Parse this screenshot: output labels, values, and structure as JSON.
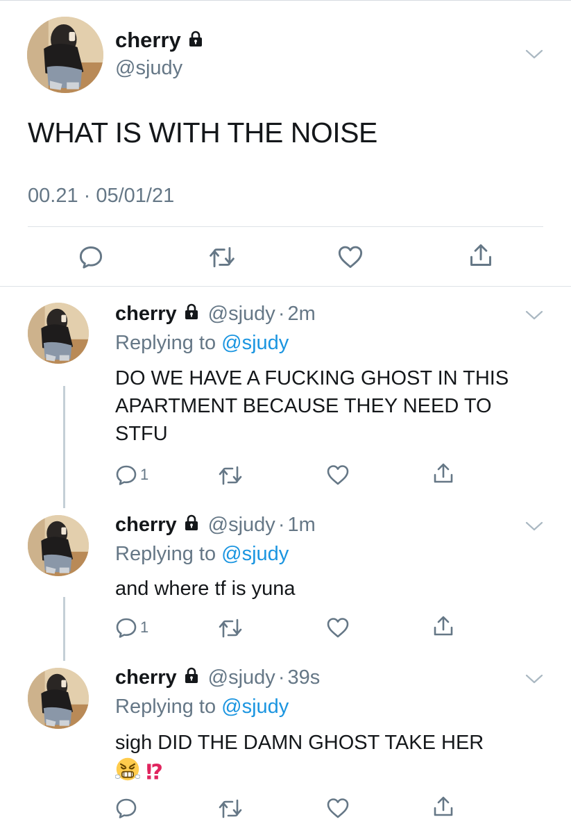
{
  "main_tweet": {
    "display_name": "cherry",
    "handle": "@sjudy",
    "text": "WHAT IS WITH THE NOISE",
    "timestamp": "00.21 · 05/01/21",
    "icons": [
      "lock-icon",
      "chevron-down-icon",
      "reply-icon",
      "retweet-icon",
      "like-icon",
      "share-icon"
    ]
  },
  "replies": [
    {
      "display_name": "cherry",
      "handle": "@sjudy",
      "separator": "·",
      "time": "2m",
      "replying_prefix": "Replying to ",
      "replying_to": "@sjudy",
      "text": "DO WE HAVE A FUCKING GHOST IN THIS APARTMENT BECAUSE THEY NEED TO STFU",
      "reply_count": "1"
    },
    {
      "display_name": "cherry",
      "handle": "@sjudy",
      "separator": "·",
      "time": "1m",
      "replying_prefix": "Replying to ",
      "replying_to": "@sjudy",
      "text": "and where tf is yuna",
      "reply_count": "1"
    },
    {
      "display_name": "cherry",
      "handle": "@sjudy",
      "separator": "·",
      "time": "39s",
      "replying_prefix": "Replying to ",
      "replying_to": "@sjudy",
      "text": "sigh DID THE DAMN GHOST TAKE HER",
      "emoji_suffix": "⁉",
      "reply_count": ""
    }
  ],
  "colors": {
    "text": "#14171a",
    "secondary": "#657786",
    "link": "#1b95e0",
    "divider": "#dde2e6",
    "thread_line": "#c4cfd6"
  }
}
